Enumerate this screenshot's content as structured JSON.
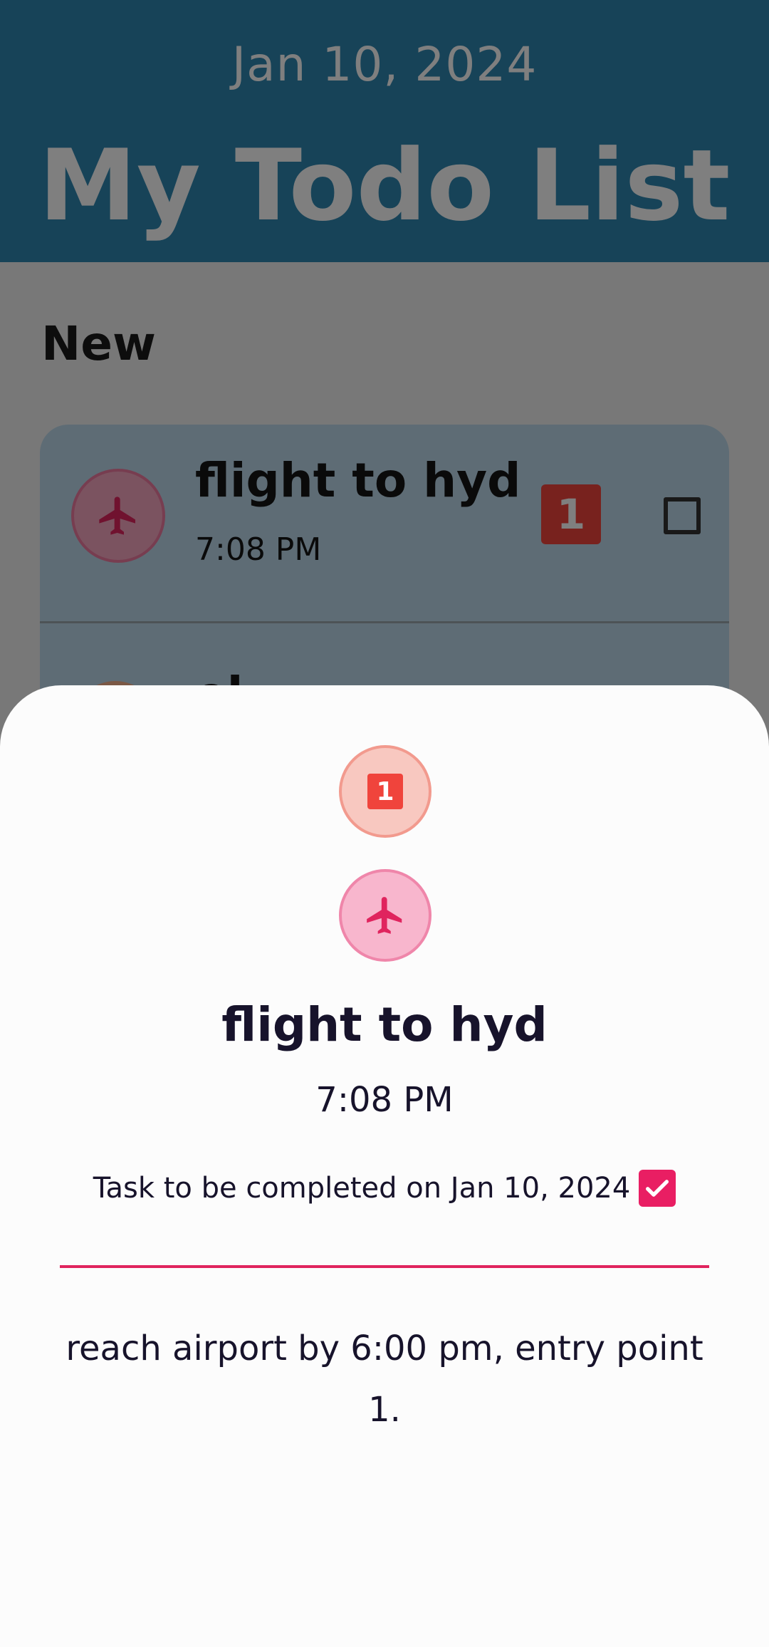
{
  "header": {
    "date": "Jan 10, 2024",
    "title": "My Todo List"
  },
  "list": {
    "section_title": "New",
    "tasks": [
      {
        "name": "flight to hyd",
        "time": "7:08 PM",
        "priority": "1",
        "category_icon": "airplane-icon",
        "completed": false
      }
    ]
  },
  "sheet": {
    "priority": "1",
    "category_icon": "airplane-icon",
    "title": "flight to hyd",
    "time": "7:08 PM",
    "due_text": "Task to be completed on Jan 10, 2024",
    "due_checked": true,
    "description": "reach airport by 6:00 pm, entry point 1."
  },
  "colors": {
    "header_bg": "#2e86b0",
    "card_bg": "#bcd8ea",
    "priority_red": "#f0443c",
    "accent_pink": "#e91e63"
  }
}
